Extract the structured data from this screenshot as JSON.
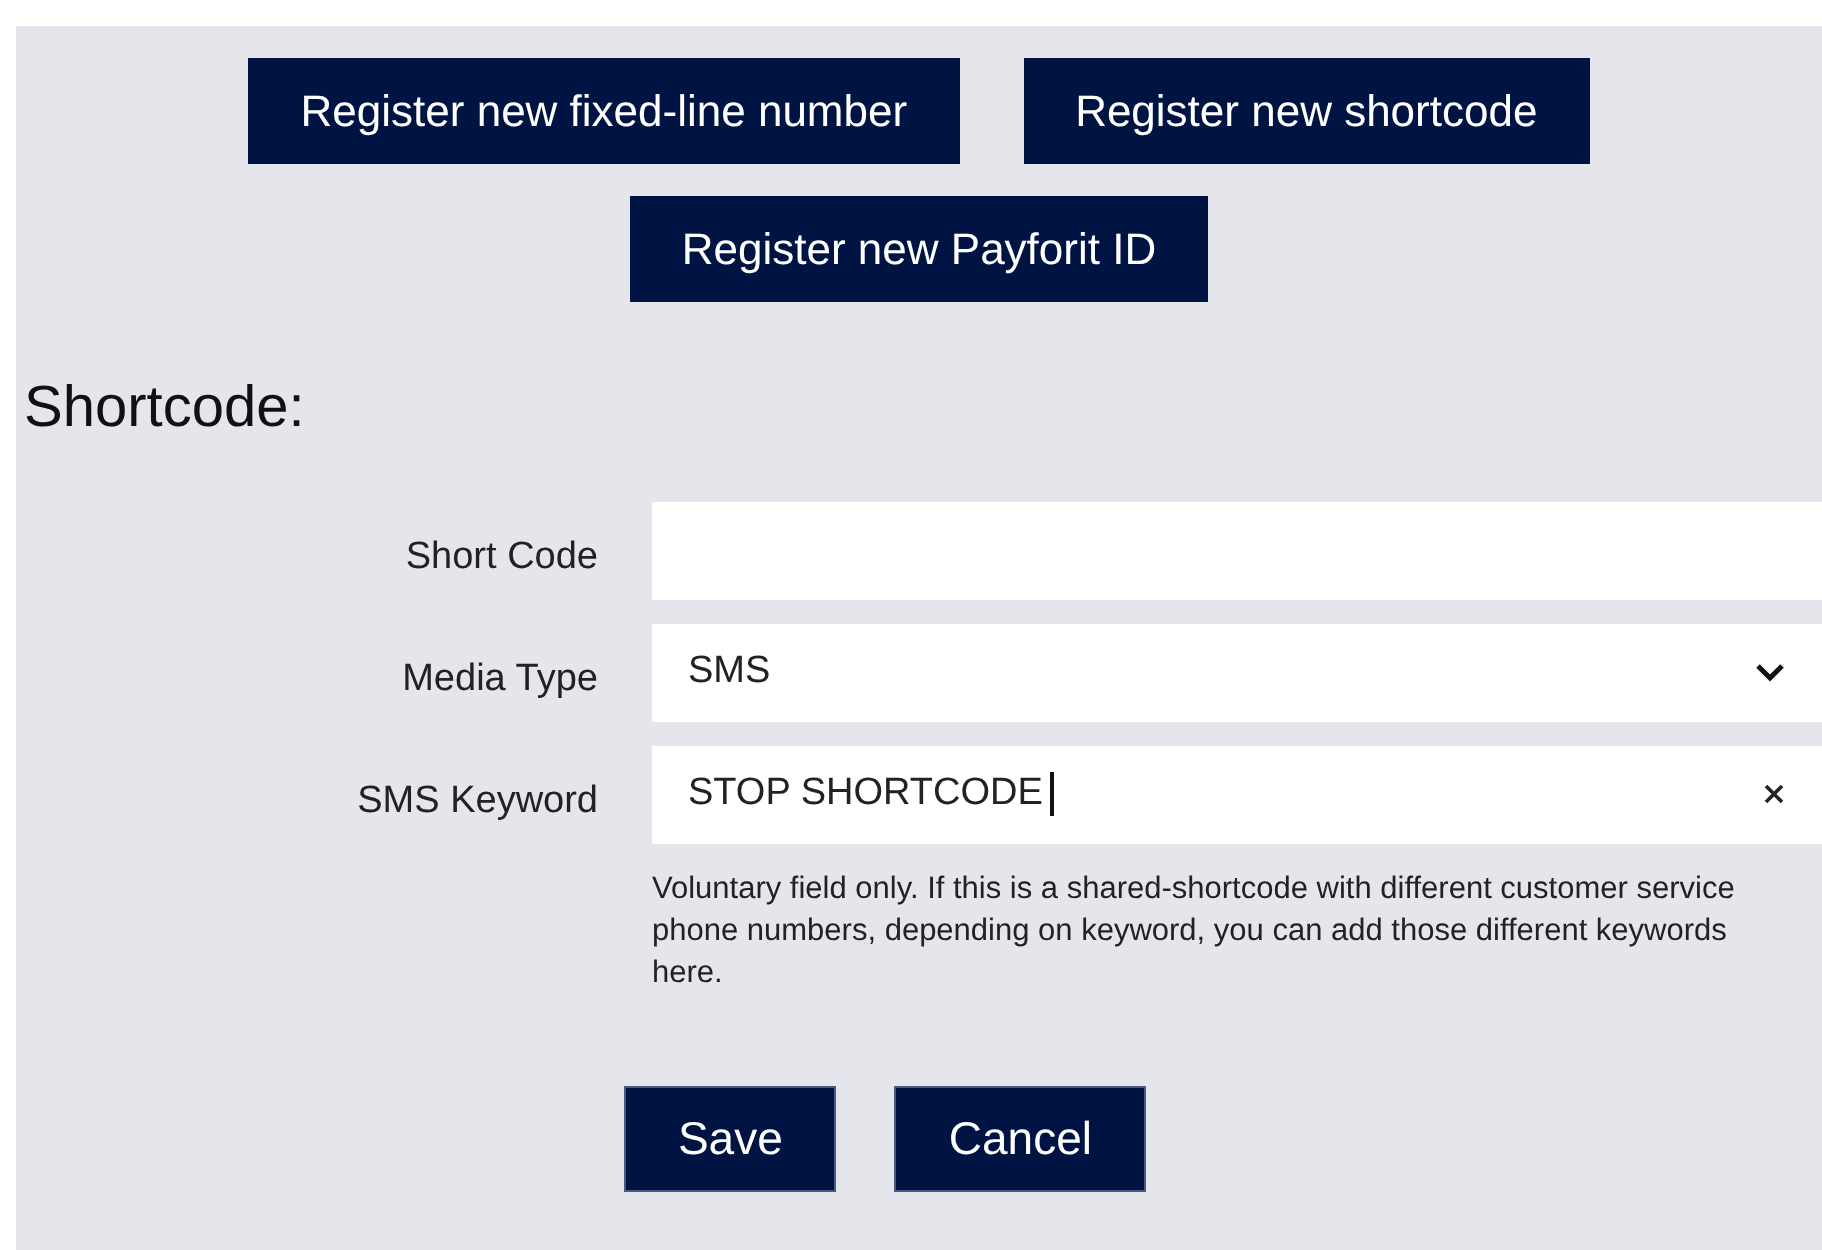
{
  "register_buttons": [
    {
      "label": "Register new fixed-line number"
    },
    {
      "label": "Register new shortcode"
    },
    {
      "label": "Register new Payforit ID"
    }
  ],
  "heading": "Shortcode:",
  "fields": [
    {
      "label": "Short Code",
      "kind": "text"
    },
    {
      "label": "Media Type",
      "kind": "select",
      "value": "SMS"
    },
    {
      "label": "SMS Keyword",
      "kind": "clearable",
      "value": "STOP SHORTCODE",
      "focused": true,
      "help": "Voluntary field only. If this is a shared-shortcode with different customer service phone numbers, depending on keyword, you can add those different keywords here."
    }
  ],
  "actions": [
    {
      "label": "Save"
    },
    {
      "label": "Cancel"
    }
  ]
}
